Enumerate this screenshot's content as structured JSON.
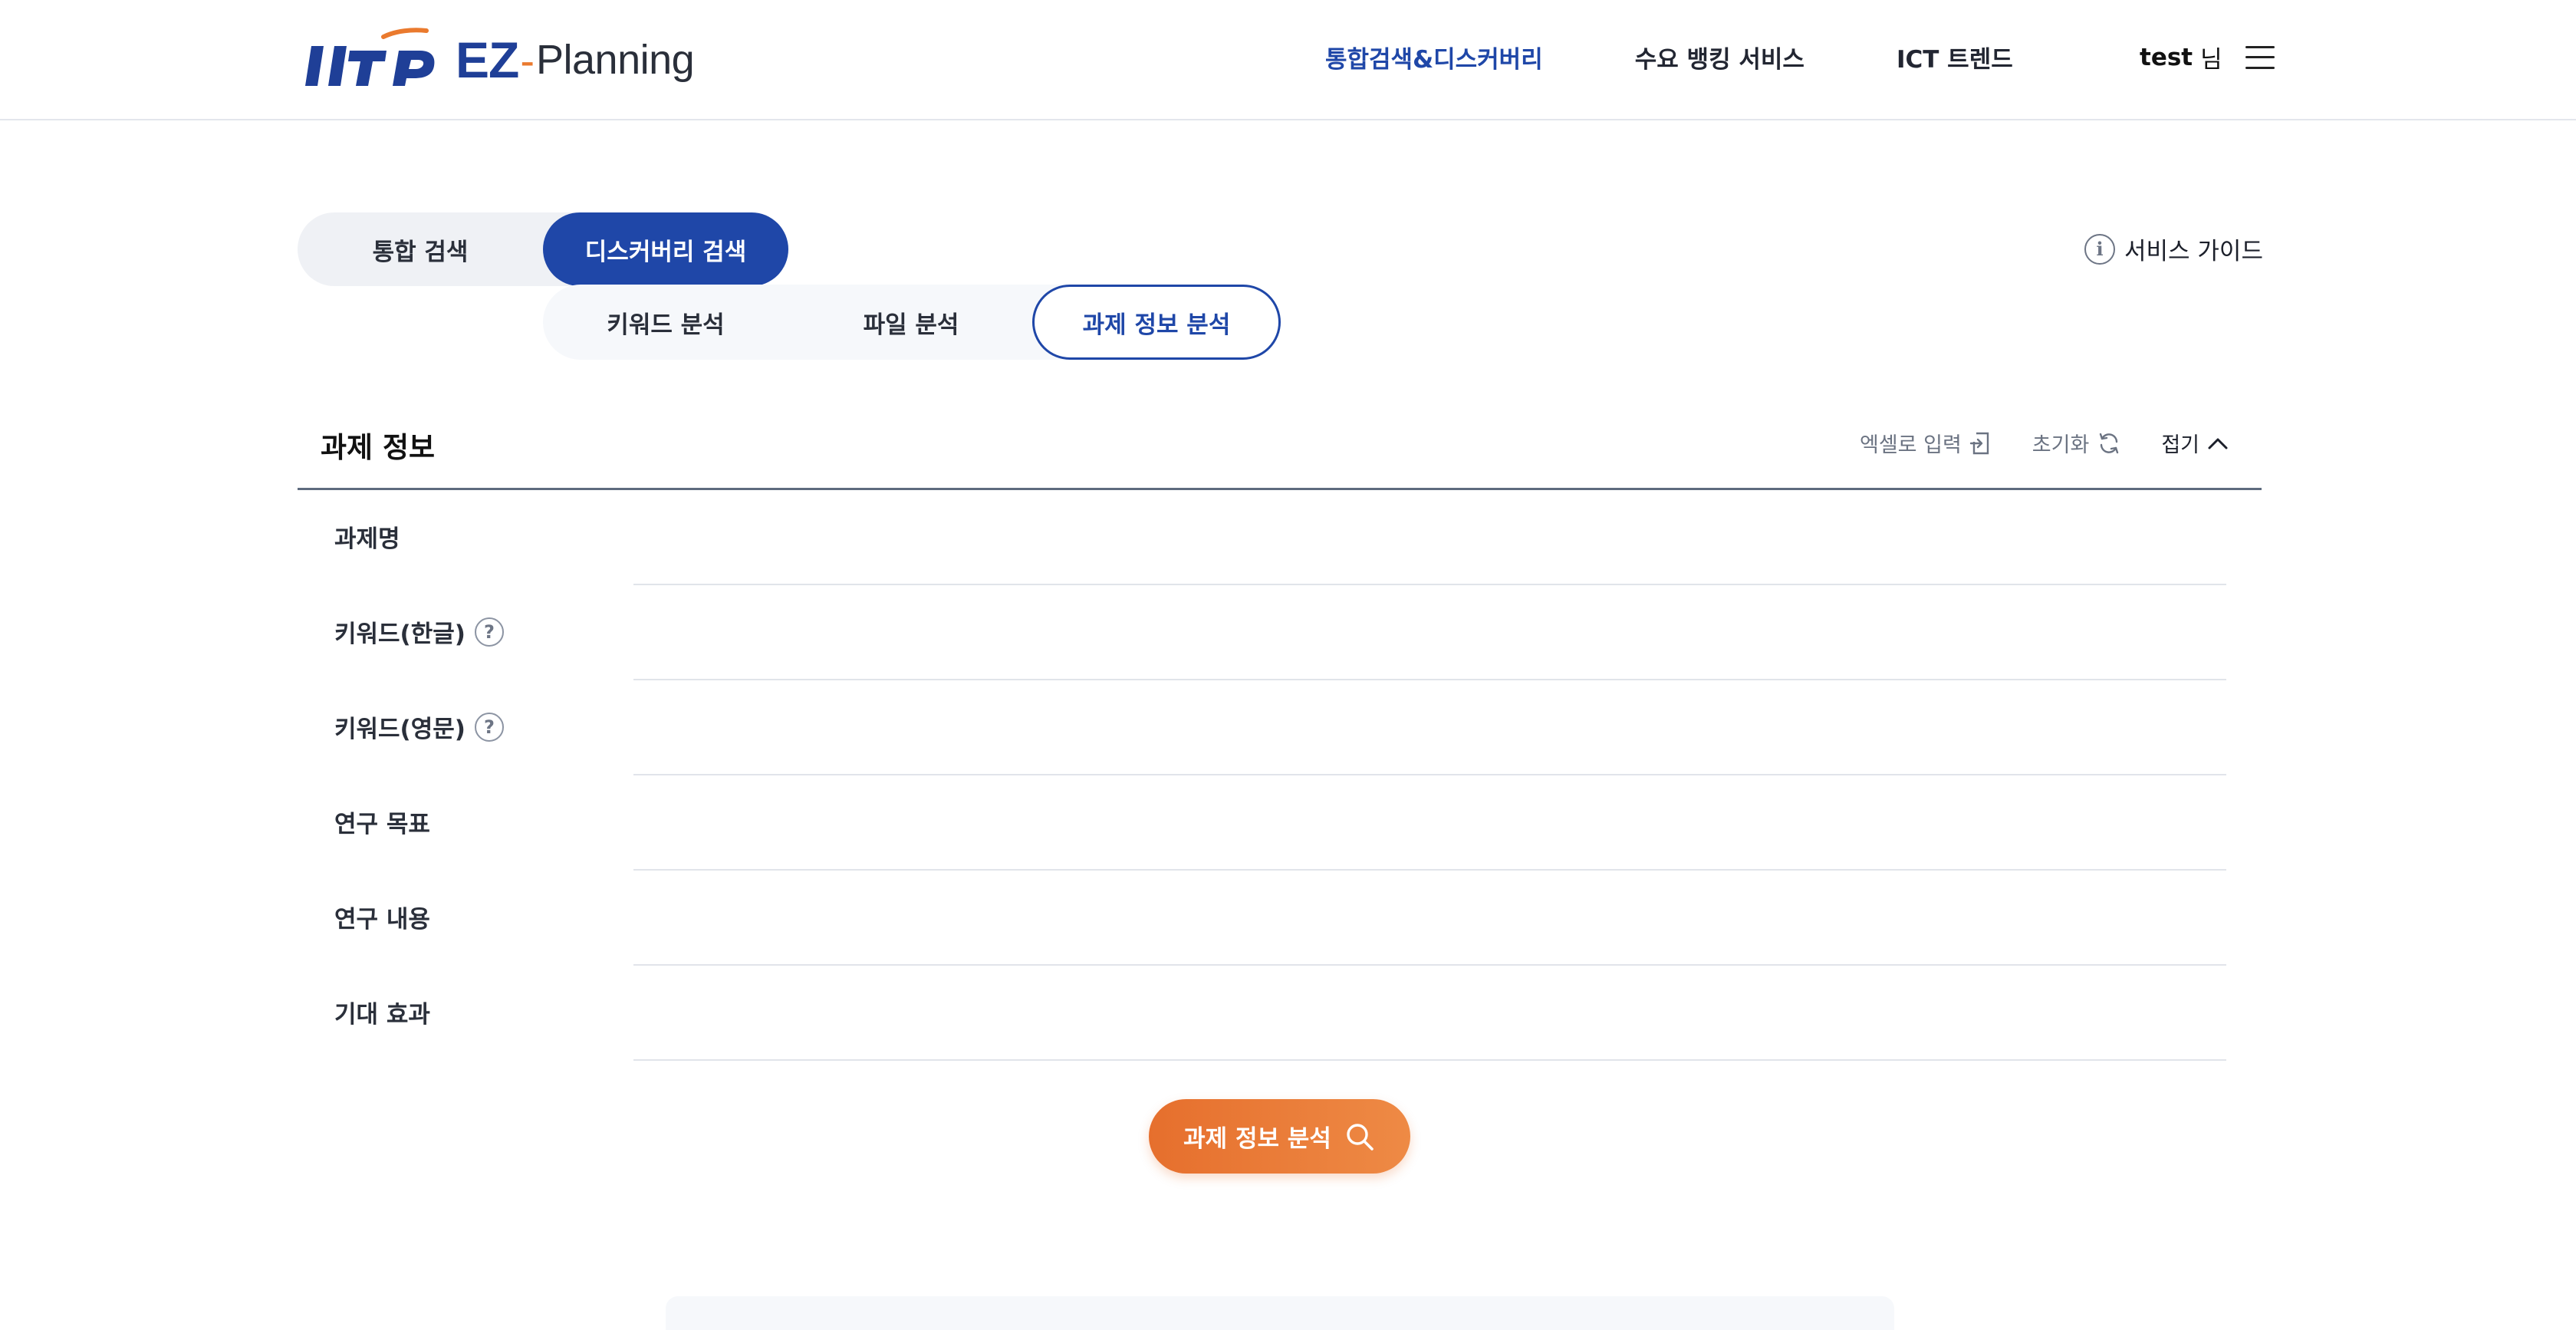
{
  "header": {
    "brand_ez": "EZ",
    "brand_dash": "-",
    "brand_planning": "Planning",
    "nav": [
      {
        "label": "통합검색&디스커버리"
      },
      {
        "label": "수요 뱅킹 서비스"
      },
      {
        "label": "ICT 트렌드"
      }
    ],
    "user_name": "test",
    "user_suffix": "님"
  },
  "tabs": {
    "main": [
      {
        "label": "통합 검색"
      },
      {
        "label": "디스커버리 검색"
      }
    ],
    "sub": [
      {
        "label": "키워드 분석"
      },
      {
        "label": "파일 분석"
      },
      {
        "label": "과제 정보 분석"
      }
    ],
    "active_main": "디스커버리 검색",
    "active_sub": "과제 정보 분석"
  },
  "guide": {
    "label": "서비스 가이드"
  },
  "section": {
    "title": "과제 정보",
    "actions": {
      "excel": "엑셀로 입력",
      "reset": "초기화",
      "fold": "접기"
    },
    "fields": [
      {
        "label": "과제명",
        "value": ""
      },
      {
        "label": "키워드(한글)",
        "value": ""
      },
      {
        "label": "키워드(영문)",
        "value": ""
      },
      {
        "label": "연구 목표",
        "value": ""
      },
      {
        "label": "연구 내용",
        "value": ""
      },
      {
        "label": "기대 효과",
        "value": ""
      }
    ]
  },
  "submit": {
    "label": "과제 정보 분석"
  },
  "colors": {
    "primary": "#1f47a8",
    "accent": "#e66f2d"
  }
}
